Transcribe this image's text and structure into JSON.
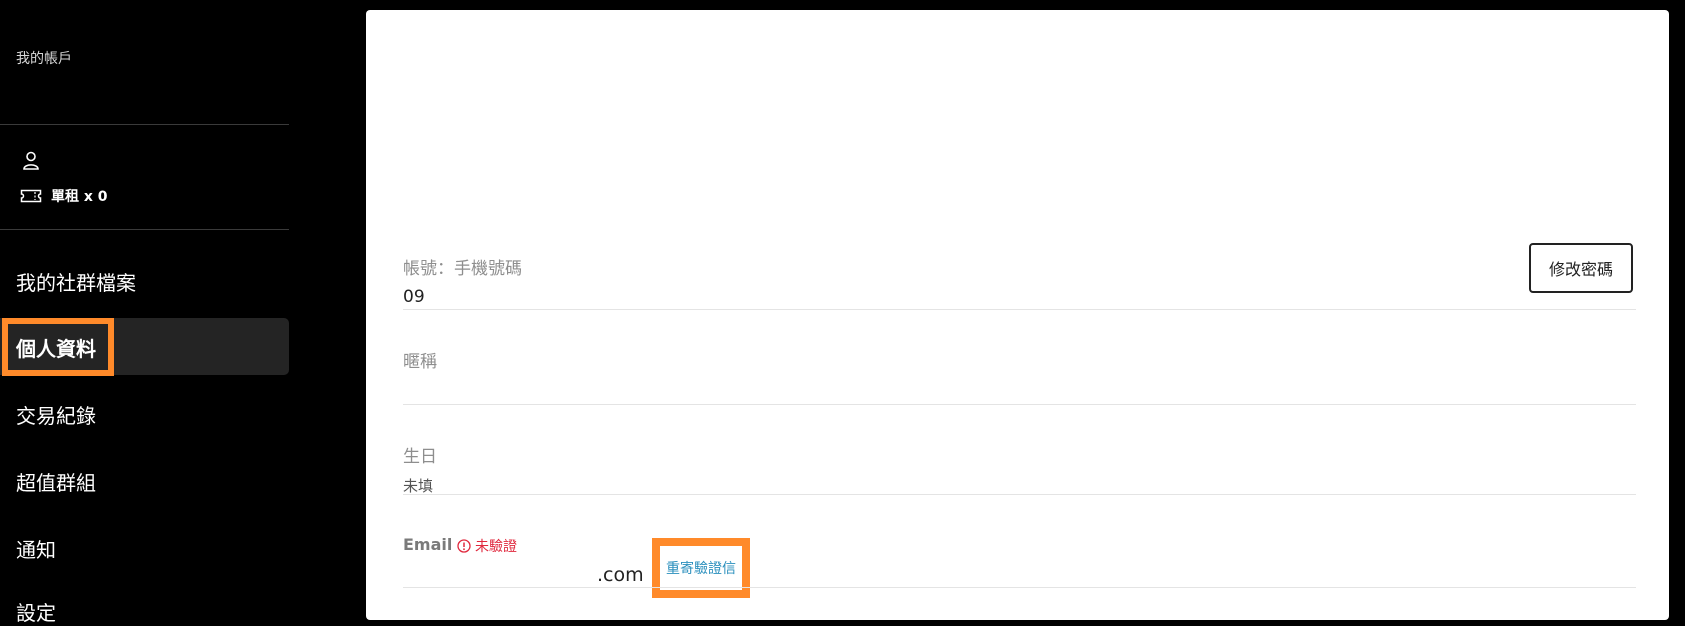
{
  "sidebar": {
    "account_title": "我的帳戶",
    "ticket_label": "單租 x 0",
    "nav": [
      {
        "label": "我的社群檔案"
      },
      {
        "label": "個人資料"
      },
      {
        "label": "交易紀錄"
      },
      {
        "label": "超值群組"
      },
      {
        "label": "通知"
      },
      {
        "label": "設定"
      }
    ]
  },
  "profile": {
    "account_label": "帳號：手機號碼",
    "account_value": "09",
    "nickname_label": "暱稱",
    "birthday_label": "生日",
    "birthday_value": "未填",
    "email_label": "Email",
    "email_status": "未驗證",
    "email_value": ".com",
    "resend_label": "重寄驗證信",
    "change_password_label": "修改密碼"
  },
  "colors": {
    "highlight": "#ff8a2a",
    "warning": "#e0283d",
    "link": "#2a8fbd"
  }
}
